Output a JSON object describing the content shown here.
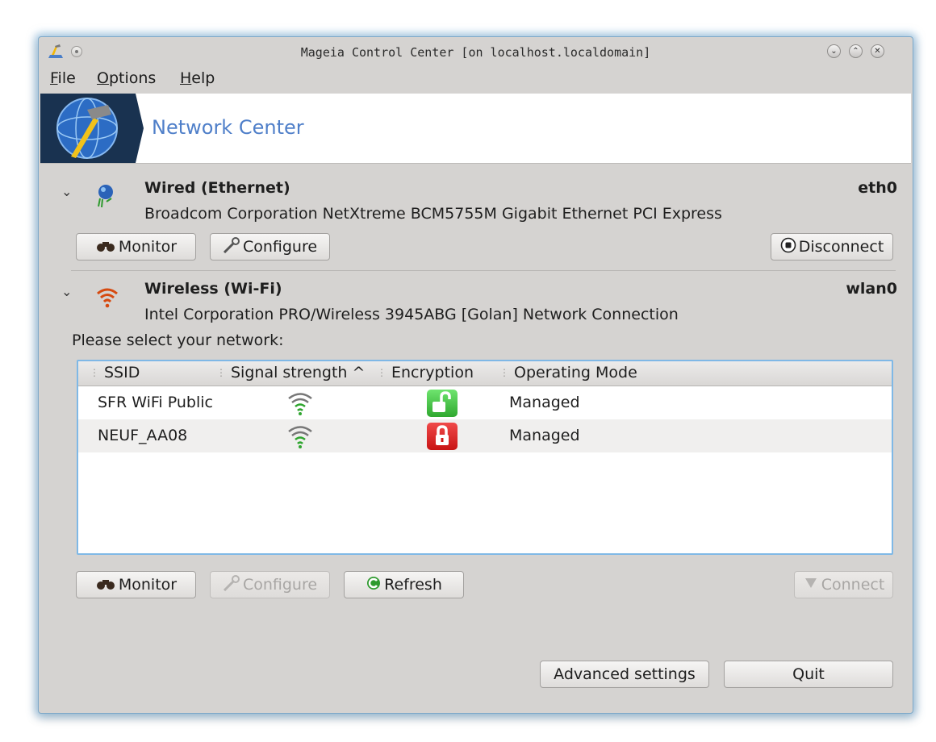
{
  "window": {
    "title": "Mageia Control Center  [on localhost.localdomain]"
  },
  "menu": {
    "file": "F",
    "file_rest": "ile",
    "options": "O",
    "options_rest": "ptions",
    "help": "H",
    "help_rest": "elp"
  },
  "banner": {
    "title": "Network Center"
  },
  "wired": {
    "title": "Wired (Ethernet)",
    "interface": "eth0",
    "description": "Broadcom Corporation NetXtreme BCM5755M Gigabit Ethernet PCI Express",
    "buttons": {
      "monitor": "Monitor",
      "configure": "Configure",
      "disconnect": "Disconnect"
    }
  },
  "wireless": {
    "title": "Wireless (Wi-Fi)",
    "interface": "wlan0",
    "description": "Intel Corporation PRO/Wireless 3945ABG [Golan] Network Connection",
    "prompt": "Please select your network:",
    "columns": {
      "ssid": "SSID",
      "signal": "Signal strength",
      "sort_indicator": "^",
      "encryption": "Encryption",
      "mode": "Operating Mode"
    },
    "networks": [
      {
        "ssid": "SFR WiFi Public",
        "encryption": "open",
        "mode": "Managed"
      },
      {
        "ssid": "NEUF_AA08",
        "encryption": "locked",
        "mode": "Managed"
      }
    ],
    "buttons": {
      "monitor": "Monitor",
      "configure": "Configure",
      "refresh": "Refresh",
      "connect": "Connect"
    }
  },
  "footer": {
    "advanced": "Advanced settings",
    "quit": "Quit"
  },
  "colors": {
    "accent": "#4f7fc9",
    "open_lock": "#3ec23e",
    "closed_lock": "#e02020",
    "wifi_signal": "#2fa52f",
    "wifi_device": "#d64a10"
  }
}
